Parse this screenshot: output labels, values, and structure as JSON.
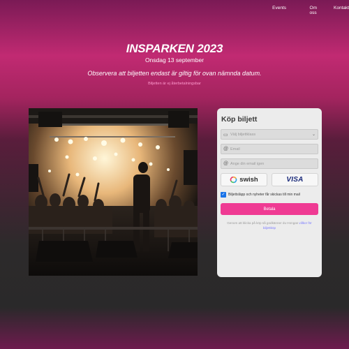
{
  "nav": {
    "items": [
      "Events",
      "Om oss",
      "Kontakt"
    ]
  },
  "hero": {
    "title": "INSPARKEN 2023",
    "date": "Onsdag 13 september",
    "notice": "Observera att biljetten endast är giltig för ovan nämnda datum.",
    "small_note": "Biljetten är ej återbetalningsbar"
  },
  "photo": {
    "alt": "Artist performing on stage in front of a crowd with bright stage lights"
  },
  "card": {
    "title": "Köp biljett",
    "ticket_class_placeholder": "Välj biljettklass",
    "email_placeholder": "Email",
    "email_repeat_placeholder": "Ange din email igen",
    "payment_methods": [
      "swish",
      "VISA"
    ],
    "newsletter_label": "Biljettsläpp och nyheter får skickas till min mail",
    "newsletter_checked": true,
    "pay_button": "Betala",
    "terms_text": "Genom att klicka på köp så godkänner du Hongas",
    "terms_link": "villkor för biljettköp"
  },
  "colors": {
    "accent": "#ef3a93",
    "checkbox": "#1a73e8"
  }
}
